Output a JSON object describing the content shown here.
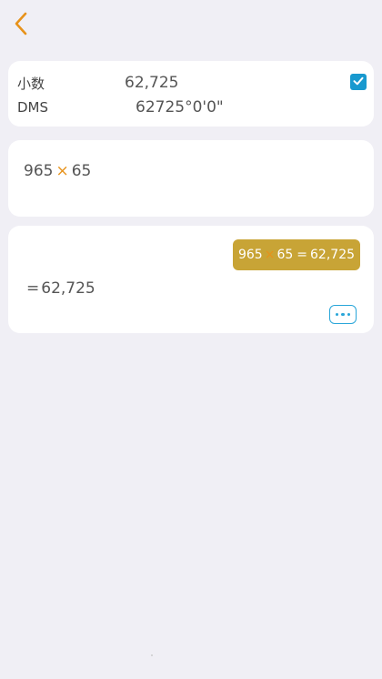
{
  "nav": {
    "back_icon": "chevron-left-icon",
    "accent_color": "#e7921a"
  },
  "conversion": {
    "decimal_label": "小数",
    "decimal_value": "62,725",
    "dms_label": "DMS",
    "dms_value": "62725°0'0\"",
    "checkbox_checked": true,
    "checkbox_color": "#1899cf"
  },
  "expression": {
    "operand1": "965",
    "operator": "×",
    "operand2": "65"
  },
  "result": {
    "history": {
      "operand1": "965",
      "operator": "×",
      "operand2": "65",
      "equals": "=",
      "value": "62,725",
      "bg_color": "#c8a436"
    },
    "equals": "=",
    "value": "62,725",
    "more_icon": "more-dots-icon"
  }
}
